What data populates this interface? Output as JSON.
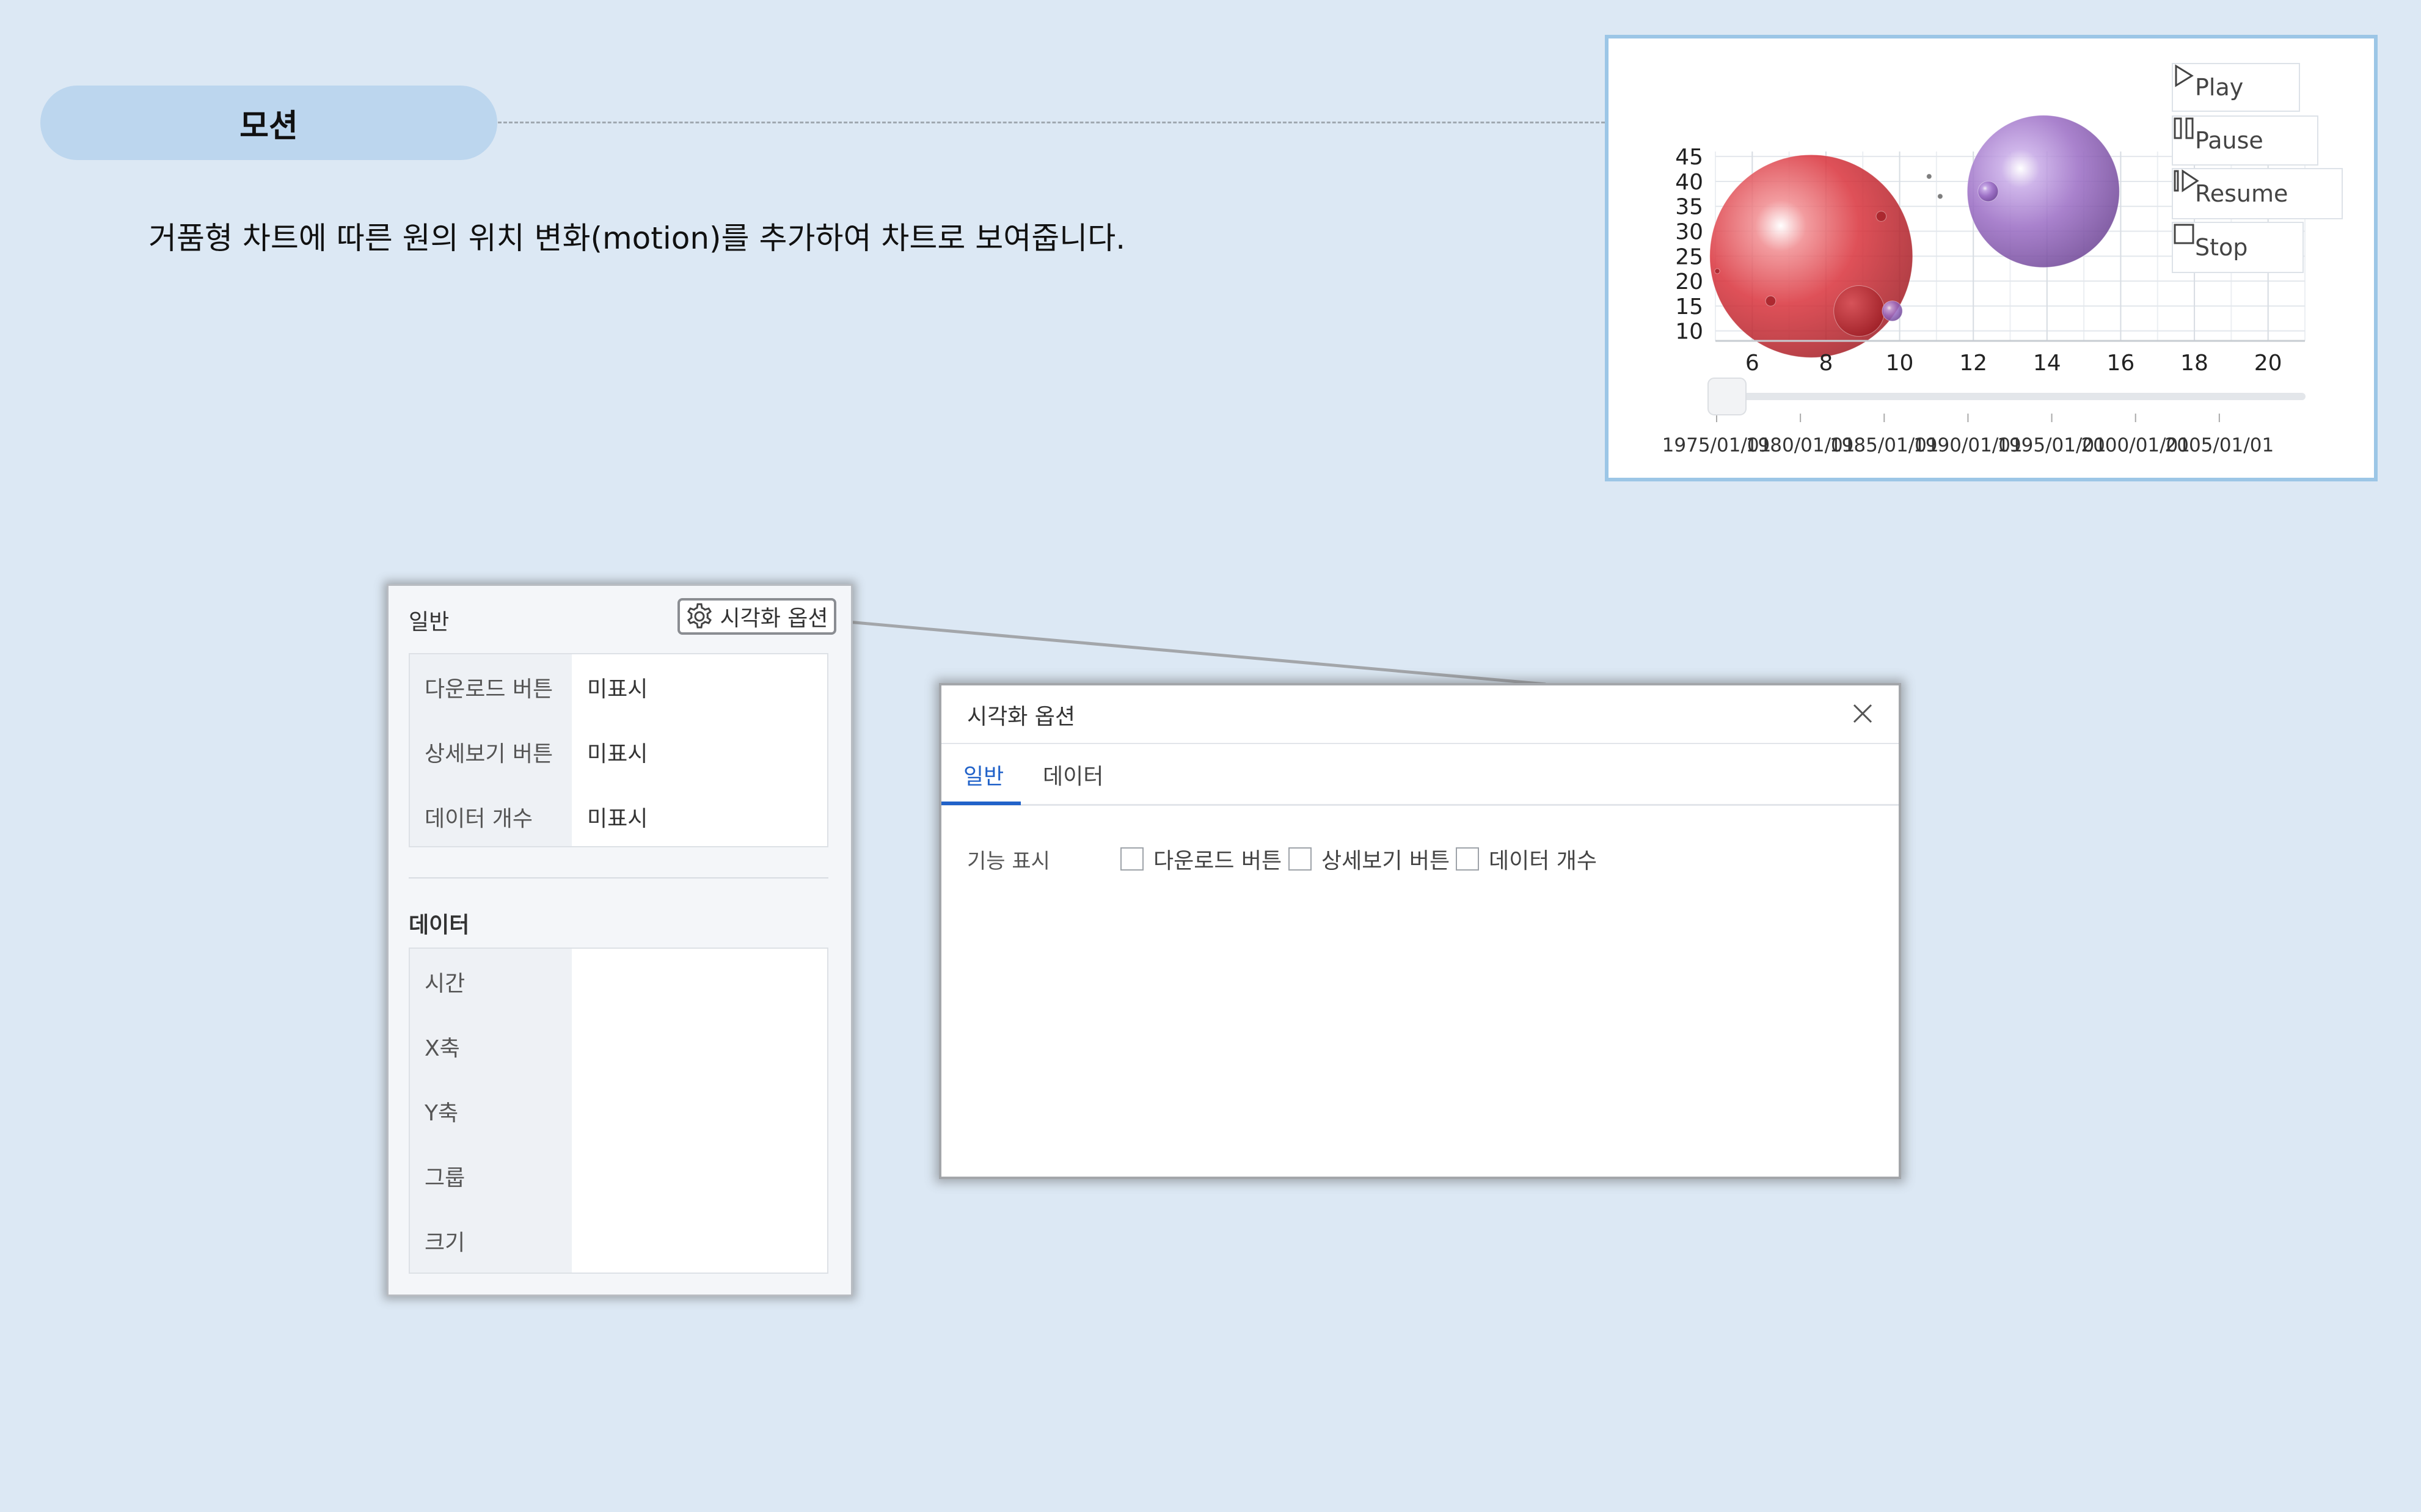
{
  "header": {
    "title": "모션",
    "description": "거품형 차트에 따른 원의 위치 변화(motion)를 추가하여 차트로 보여줍니다."
  },
  "chart_preview": {
    "controls": [
      {
        "label": "Play",
        "icon": "play-icon"
      },
      {
        "label": "Pause",
        "icon": "pause-icon"
      },
      {
        "label": "Resume",
        "icon": "resume-icon"
      },
      {
        "label": "Stop",
        "icon": "stop-icon"
      }
    ],
    "timeline_labels": [
      "1975/01/01",
      "1980/01/01",
      "1985/01/01",
      "1990/01/01",
      "1995/01/01",
      "2000/01/01",
      "2005/01/01"
    ],
    "timeline_position": 0
  },
  "chart_data": {
    "type": "scatter",
    "variant": "bubble",
    "x_ticks": [
      6,
      8,
      10,
      12,
      14,
      16,
      18,
      20
    ],
    "y_ticks": [
      10,
      15,
      20,
      25,
      30,
      35,
      40,
      45
    ],
    "xlim": [
      5,
      21
    ],
    "ylim": [
      8,
      46
    ],
    "grid": true,
    "points": [
      {
        "x": 7.6,
        "y": 25,
        "size": 40,
        "color": "#d9323b"
      },
      {
        "x": 13.9,
        "y": 38,
        "size": 30,
        "color": "#9a6cc4"
      },
      {
        "x": 8.9,
        "y": 14,
        "size": 10,
        "color": "#b8282f"
      },
      {
        "x": 12.4,
        "y": 38,
        "size": 4,
        "color": "#9a6cc4"
      },
      {
        "x": 9.8,
        "y": 14,
        "size": 4,
        "color": "#9a6cc4"
      },
      {
        "x": 6.5,
        "y": 16,
        "size": 2,
        "color": "#a52229"
      },
      {
        "x": 9.5,
        "y": 33,
        "size": 2,
        "color": "#a52229"
      },
      {
        "x": 10.8,
        "y": 41,
        "size": 1,
        "color": "#666666"
      },
      {
        "x": 11.1,
        "y": 37,
        "size": 1,
        "color": "#666666"
      },
      {
        "x": 5.05,
        "y": 22,
        "size": 1,
        "color": "#a52229"
      }
    ]
  },
  "settings_panel": {
    "general_heading": "일반",
    "viz_option_label": "시각화 옵션",
    "general_rows": [
      {
        "key": "다운로드 버튼",
        "value": "미표시"
      },
      {
        "key": "상세보기 버튼",
        "value": "미표시"
      },
      {
        "key": "데이터 개수",
        "value": "미표시"
      }
    ],
    "data_heading": "데이터",
    "data_rows": [
      {
        "key": "시간",
        "value": ""
      },
      {
        "key": "X축",
        "value": ""
      },
      {
        "key": "Y축",
        "value": ""
      },
      {
        "key": "그룹",
        "value": ""
      },
      {
        "key": "크기",
        "value": ""
      }
    ]
  },
  "dialog": {
    "title": "시각화 옵션",
    "tabs": [
      "일반",
      "데이터"
    ],
    "active_tab": "일반",
    "feature_label": "기능 표시",
    "checkboxes": [
      {
        "label": "다운로드 버튼",
        "checked": false
      },
      {
        "label": "상세보기 버튼",
        "checked": false
      },
      {
        "label": "데이터 개수",
        "checked": false
      }
    ]
  }
}
